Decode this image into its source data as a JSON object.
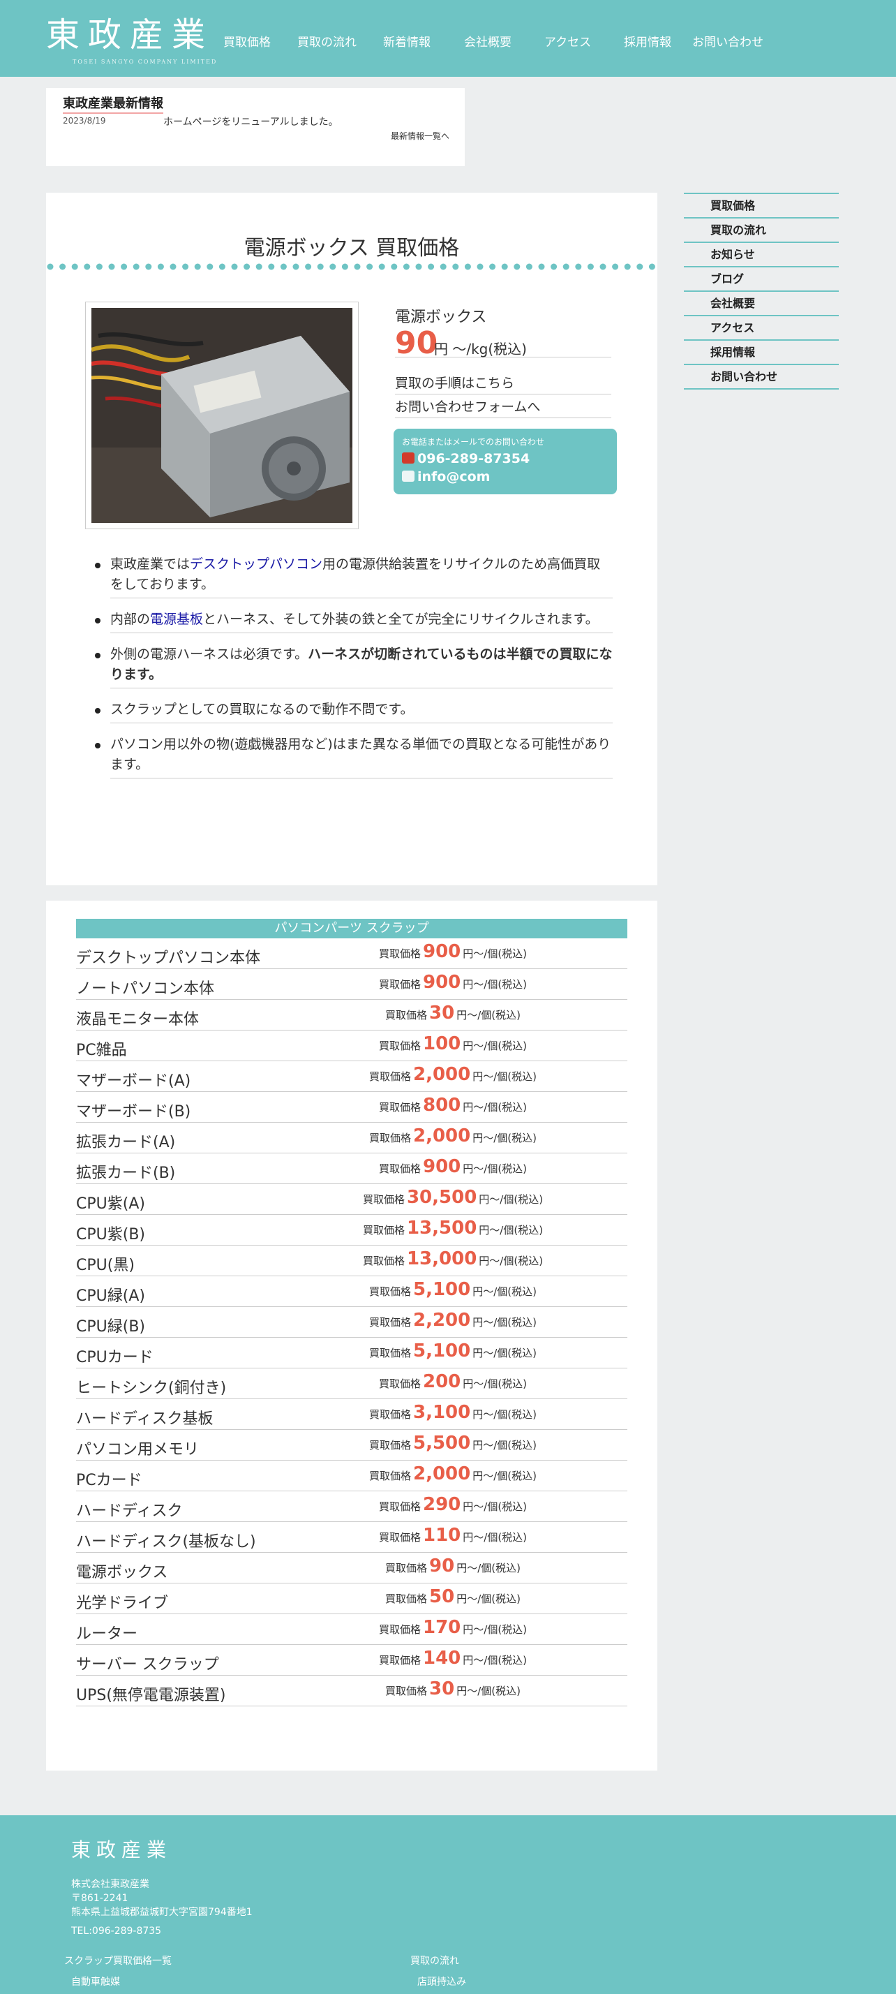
{
  "header": {
    "logo": "東政産業",
    "logo_sub": "TOSEI SANGYO COMPANY LIMITED",
    "nav": [
      "買取価格",
      "買取の流れ",
      "新着情報",
      "会社概要",
      "アクセス",
      "採用情報",
      "お問い合わせ"
    ]
  },
  "news": {
    "title": "東政産業最新情報",
    "date": "2023/8/19",
    "text": "ホームページをリニューアルしました。",
    "more": "最新情報一覧へ"
  },
  "product": {
    "page_title": "電源ボックス 買取価格",
    "name": "電源ボックス",
    "price": "90",
    "unit": "円 ～/kg(税込)",
    "link1": "買取の手順はこちら",
    "link2": "お問い合わせフォームへ",
    "contact_lead": "お電話またはメールでのお問い合わせ",
    "phone": "096-289-87354",
    "email": "info@com",
    "bullets": [
      {
        "pre": "東政産業では",
        "link": "デスクトップパソコン",
        "post": "用の電源供給装置をリサイクルのため高価買取をしております。"
      },
      {
        "pre": "内部の",
        "link": "電源基板",
        "post": "とハーネス、そして外装の鉄と全てが完全にリサイクルされます。"
      },
      {
        "pre": "外側の電源ハーネスは必須です。",
        "bold": "ハーネスが切断されているものは半額での買取になります。"
      },
      {
        "pre": "スクラップとしての買取になるので動作不問です。"
      },
      {
        "pre": "パソコン用以外の物(遊戯機器用など)はまた異なる単価での買取となる可能性があります。"
      }
    ]
  },
  "sidebar": [
    "買取価格",
    "買取の流れ",
    "お知らせ",
    "ブログ",
    "会社概要",
    "アクセス",
    "採用情報",
    "お問い合わせ"
  ],
  "price_table": {
    "heading": "パソコンパーツ スクラップ",
    "label": "買取価格",
    "unit": "円～/個(税込)",
    "rows": [
      {
        "name": "デスクトップパソコン本体",
        "price": "900"
      },
      {
        "name": "ノートパソコン本体",
        "price": "900"
      },
      {
        "name": "液晶モニター本体",
        "price": "30"
      },
      {
        "name": "PC雑品",
        "price": "100"
      },
      {
        "name": "マザーボード(A)",
        "price": "2,000"
      },
      {
        "name": "マザーボード(B)",
        "price": "800"
      },
      {
        "name": "拡張カード(A)",
        "price": "2,000"
      },
      {
        "name": "拡張カード(B)",
        "price": "900"
      },
      {
        "name": "CPU紫(A)",
        "price": "30,500"
      },
      {
        "name": "CPU紫(B)",
        "price": "13,500"
      },
      {
        "name": "CPU(黒)",
        "price": "13,000"
      },
      {
        "name": "CPU緑(A)",
        "price": "5,100"
      },
      {
        "name": "CPU緑(B)",
        "price": "2,200"
      },
      {
        "name": "CPUカード",
        "price": "5,100"
      },
      {
        "name": "ヒートシンク(銅付き)",
        "price": "200"
      },
      {
        "name": "ハードディスク基板",
        "price": "3,100"
      },
      {
        "name": "パソコン用メモリ",
        "price": "5,500"
      },
      {
        "name": "PCカード",
        "price": "2,000"
      },
      {
        "name": "ハードディスク",
        "price": "290"
      },
      {
        "name": "ハードディスク(基板なし)",
        "price": "110"
      },
      {
        "name": "電源ボックス",
        "price": "90"
      },
      {
        "name": "光学ドライブ",
        "price": "50"
      },
      {
        "name": "ルーター",
        "price": "170"
      },
      {
        "name": "サーバー スクラップ",
        "price": "140"
      },
      {
        "name": "UPS(無停電電源装置)",
        "price": "30"
      }
    ]
  },
  "footer": {
    "logo": "東政産業",
    "company": "株式会社東政産業",
    "zip": "〒861-2241",
    "address": "熊本県上益城郡益城町大字宮園794番地1",
    "tel": "TEL:096-289-8735",
    "link_left": "スクラップ買取価格一覧",
    "sub_left": "自動車触媒",
    "link_right": "買取の流れ",
    "sub_right": "店頭持込み"
  },
  "colors": {
    "accent": "#6ec4c4",
    "price": "#e85e48",
    "link": "#1a1aa6"
  }
}
